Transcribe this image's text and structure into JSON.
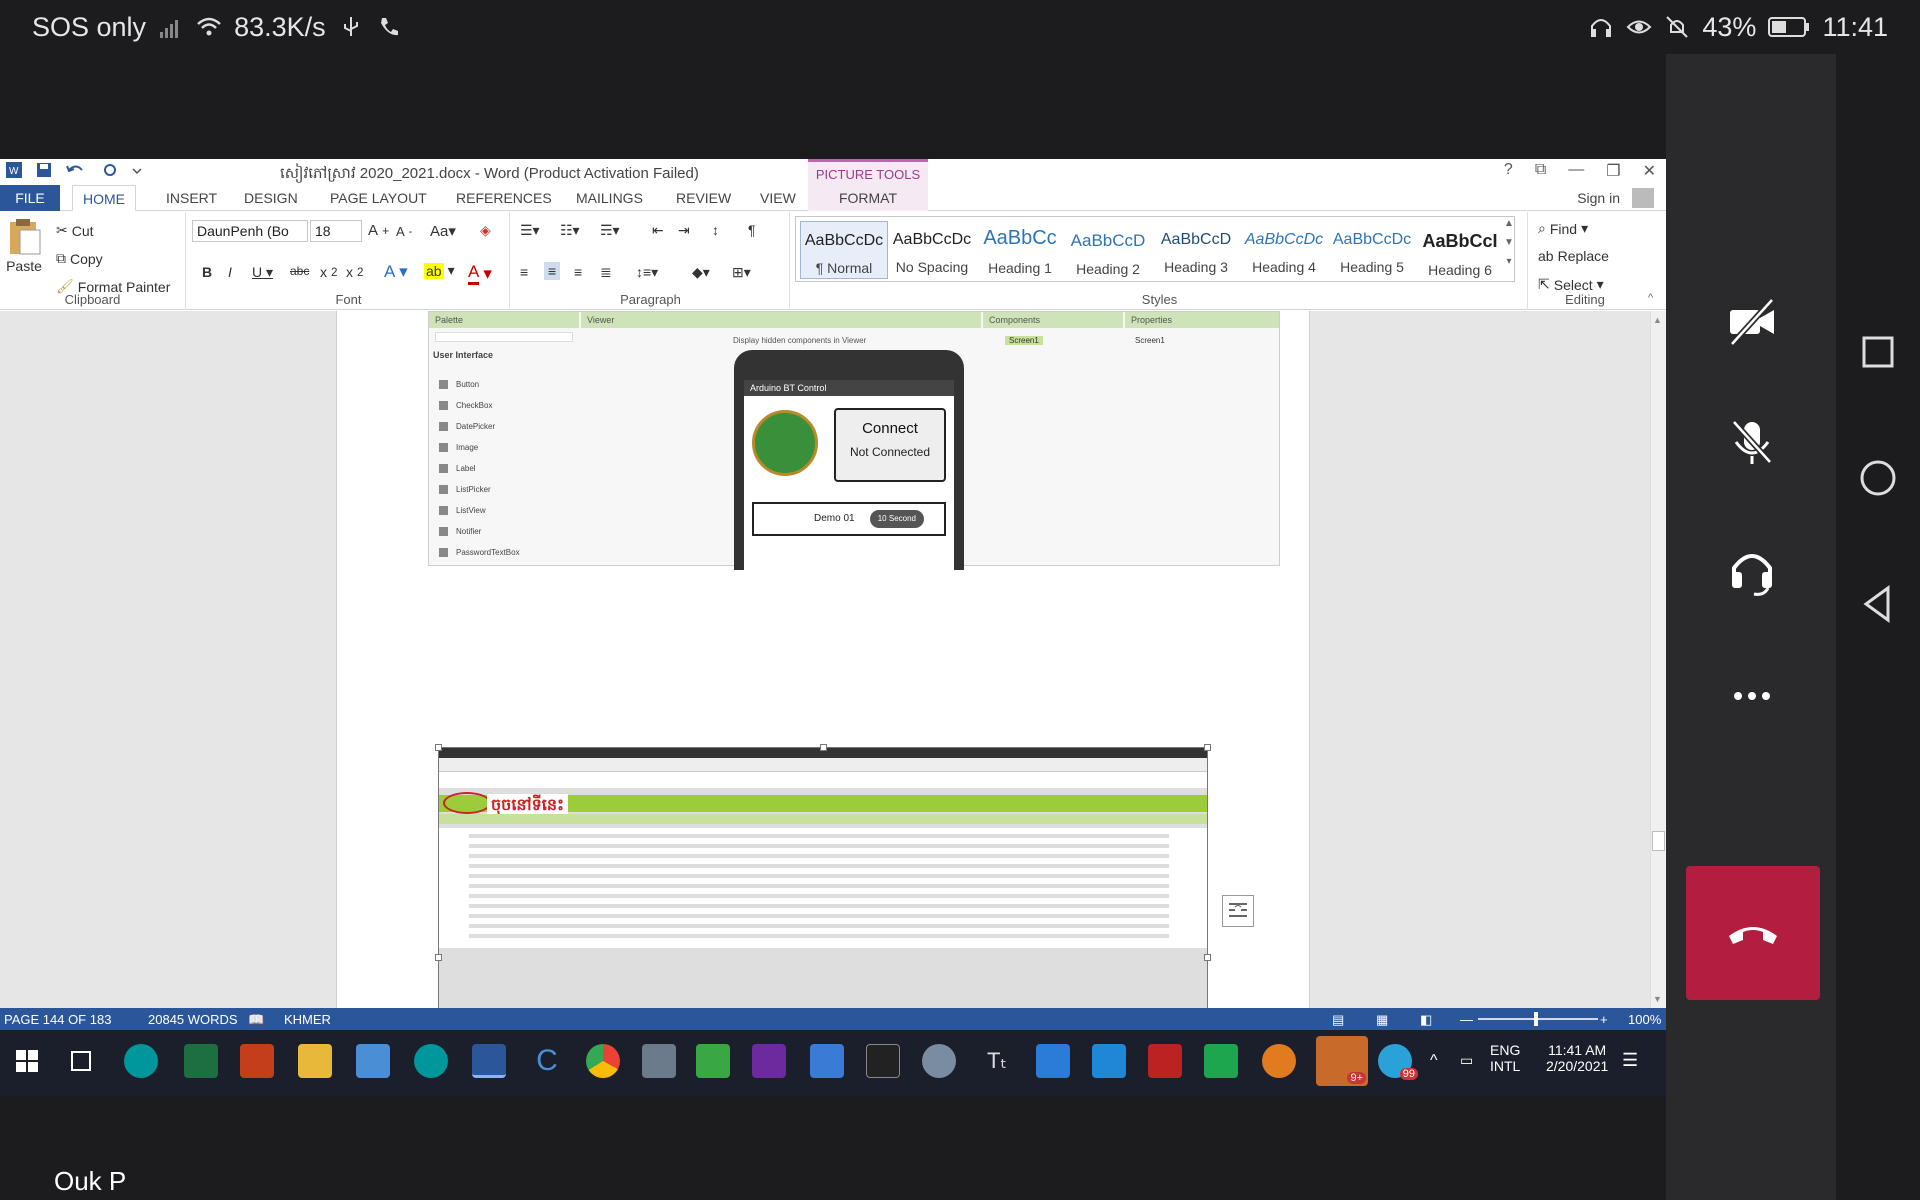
{
  "phone_status": {
    "network": "SOS only",
    "speed": "83.3K/s",
    "battery": "43%",
    "time": "11:41"
  },
  "word": {
    "title": "សៀវភៅស្រាវ 2020_2021.docx - Word (Product Activation Failed)",
    "contextual_tab_group": "PICTURE TOOLS",
    "tabs": [
      "FILE",
      "HOME",
      "INSERT",
      "DESIGN",
      "PAGE LAYOUT",
      "REFERENCES",
      "MAILINGS",
      "REVIEW",
      "VIEW",
      "FORMAT"
    ],
    "active_tab": "HOME",
    "sign_in": "Sign in",
    "clipboard": {
      "paste": "Paste",
      "cut": "Cut",
      "copy": "Copy",
      "format_painter": "Format Painter",
      "label": "Clipboard"
    },
    "font": {
      "name": "DaunPenh (Bo",
      "size": "18",
      "label": "Font"
    },
    "paragraph": {
      "label": "Paragraph"
    },
    "styles": {
      "label": "Styles",
      "items": [
        {
          "preview": "AaBbCcDc",
          "name": "¶ Normal"
        },
        {
          "preview": "AaBbCcDc",
          "name": "No Spacing"
        },
        {
          "preview": "AaBbCc",
          "name": "Heading 1"
        },
        {
          "preview": "AaBbCcD",
          "name": "Heading 2"
        },
        {
          "preview": "AaBbCcD",
          "name": "Heading 3"
        },
        {
          "preview": "AaBbCcDc",
          "name": "Heading 4"
        },
        {
          "preview": "AaBbCcDc",
          "name": "Heading 5"
        },
        {
          "preview": "AaBbCcI",
          "name": "Heading 6"
        }
      ]
    },
    "editing": {
      "find": "Find",
      "replace": "Replace",
      "select": "Select",
      "label": "Editing"
    },
    "status": {
      "page": "PAGE 144 OF 183",
      "words": "20845 WORDS",
      "language": "KHMER",
      "zoom": "100%"
    }
  },
  "embedded_ai": {
    "palette": "Palette",
    "viewer": "Viewer",
    "components": "Components",
    "properties": "Properties",
    "display_hidden": "Display hidden components in Viewer",
    "user_interface": "User Interface",
    "palette_items": [
      "Button",
      "CheckBox",
      "DatePicker",
      "Image",
      "Label",
      "ListPicker",
      "ListView",
      "Notifier",
      "PasswordTextBox"
    ],
    "app_title": "Arduino BT Control",
    "connect": "Connect",
    "not_connected": "Not Connected",
    "demo": "Demo 01",
    "seconds": "10 Second",
    "screen1": "Screen1"
  },
  "embedded_browser": {
    "khmer_heading": "ចុចនៅទីនេះ"
  },
  "taskbar": {
    "lang_top": "ENG",
    "lang_bottom": "INTL",
    "time": "11:41 AM",
    "date": "2/20/2021",
    "badge1": "9+",
    "badge2": "99"
  },
  "caller_name": "Ouk P",
  "colors": {
    "word_blue": "#2b579a",
    "end_call_red": "#b31d3f",
    "picture_tools": "#c163ae"
  }
}
